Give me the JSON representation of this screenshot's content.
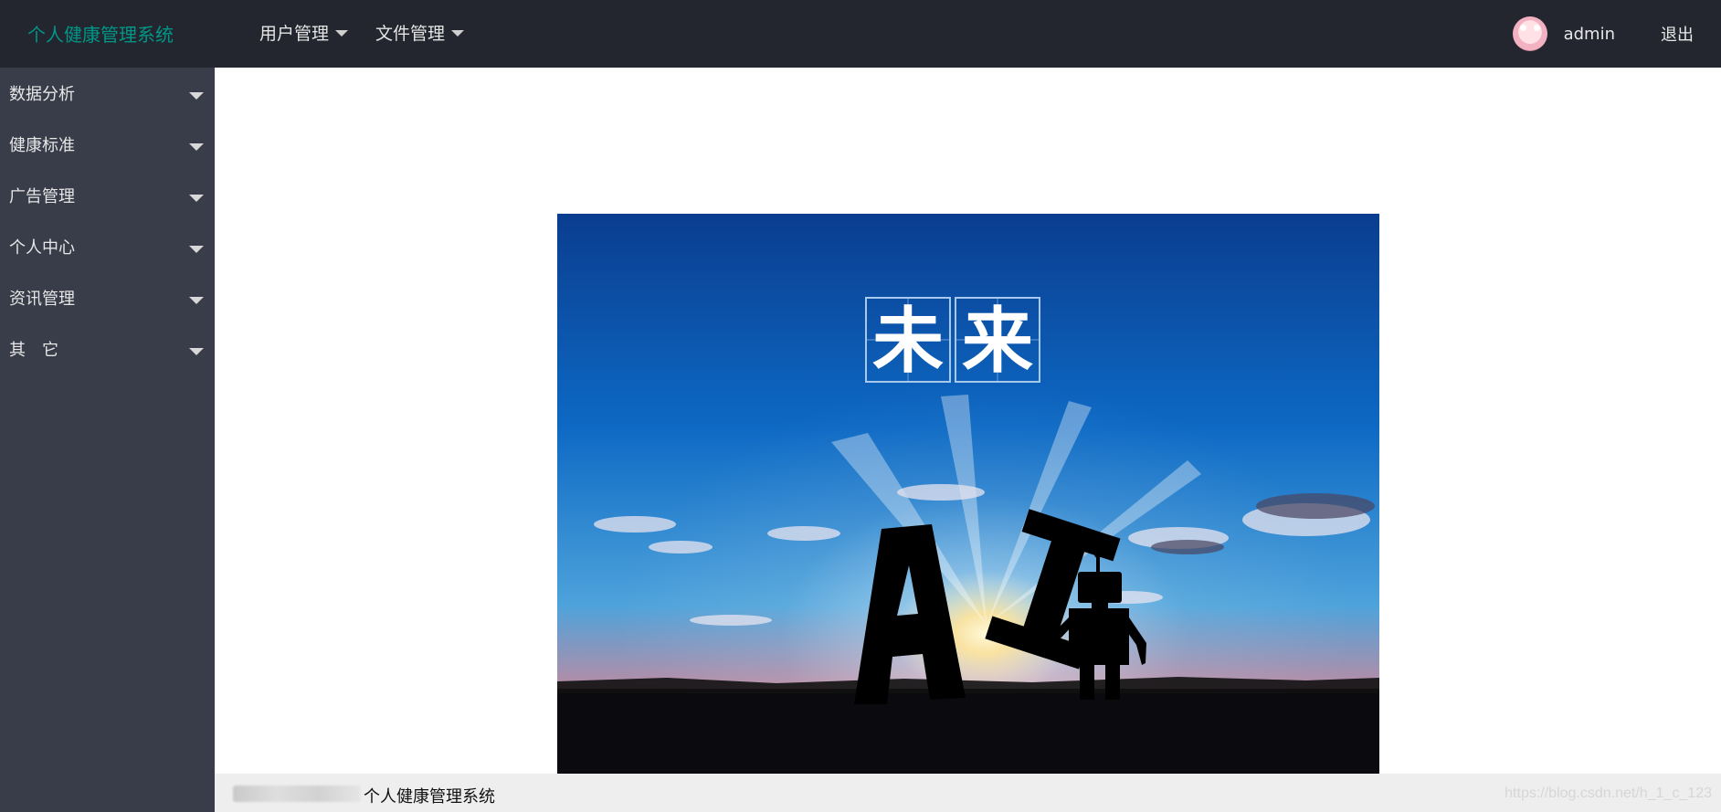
{
  "header": {
    "brand": "个人健康管理系统",
    "nav": [
      {
        "label": "用户管理"
      },
      {
        "label": "文件管理"
      }
    ],
    "username": "admin",
    "logout_label": "退出"
  },
  "sidebar": {
    "items": [
      {
        "label": "数据分析"
      },
      {
        "label": "健康标准"
      },
      {
        "label": "广告管理"
      },
      {
        "label": "个人中心"
      },
      {
        "label": "资讯管理"
      },
      {
        "label": "其　它"
      }
    ]
  },
  "hero": {
    "title_chars": [
      "未",
      "来"
    ],
    "ai_text": "AI"
  },
  "footer": {
    "text": "个人健康管理系统",
    "watermark": "https://blog.csdn.net/h_1_c_123"
  },
  "colors": {
    "topbar": "#23262e",
    "sidebar": "#393d49",
    "brand": "#009688",
    "footer": "#eeeeee"
  }
}
